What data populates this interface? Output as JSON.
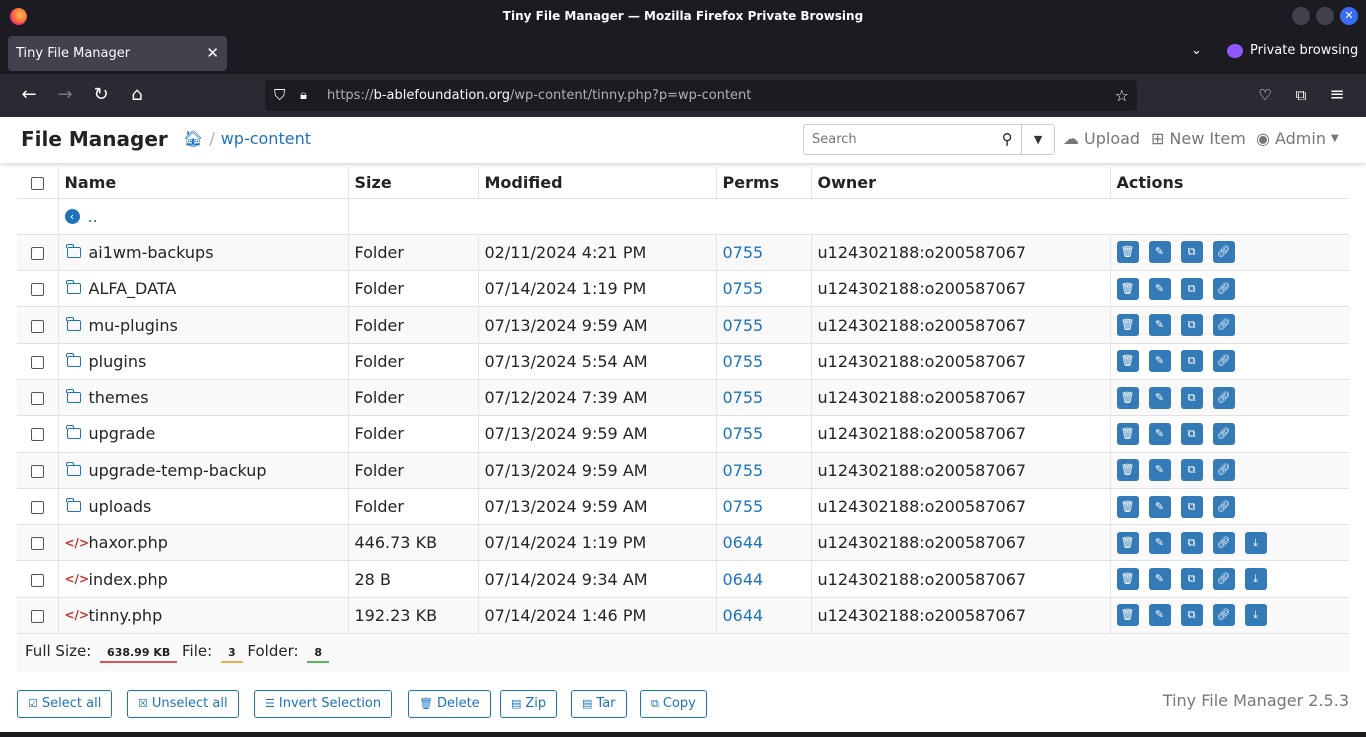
{
  "window": {
    "title": "Tiny File Manager — Mozilla Firefox Private Browsing"
  },
  "browser": {
    "tab_title": "Tiny File Manager",
    "private_label": "Private browsing",
    "url_prefix": "https://",
    "url_domain": "b-ablefoundation.org",
    "url_path": "/wp-content/tinny.php?p=wp-content"
  },
  "app": {
    "brand": "File Manager",
    "breadcrumb_sep": "/",
    "breadcrumb_current": "wp-content",
    "search_placeholder": "Search",
    "upload_label": "Upload",
    "new_item_label": "New Item",
    "admin_label": "Admin"
  },
  "table": {
    "headers": {
      "name": "Name",
      "size": "Size",
      "modified": "Modified",
      "perms": "Perms",
      "owner": "Owner",
      "actions": "Actions"
    },
    "up_label": "..",
    "rows": [
      {
        "type": "folder",
        "name": "ai1wm-backups",
        "size": "Folder",
        "modified": "02/11/2024 4:21 PM",
        "perms": "0755",
        "owner": "u124302188:o200587067"
      },
      {
        "type": "folder",
        "name": "ALFA_DATA",
        "size": "Folder",
        "modified": "07/14/2024 1:19 PM",
        "perms": "0755",
        "owner": "u124302188:o200587067"
      },
      {
        "type": "folder",
        "name": "mu-plugins",
        "size": "Folder",
        "modified": "07/13/2024 9:59 AM",
        "perms": "0755",
        "owner": "u124302188:o200587067"
      },
      {
        "type": "folder",
        "name": "plugins",
        "size": "Folder",
        "modified": "07/13/2024 5:54 AM",
        "perms": "0755",
        "owner": "u124302188:o200587067"
      },
      {
        "type": "folder",
        "name": "themes",
        "size": "Folder",
        "modified": "07/12/2024 7:39 AM",
        "perms": "0755",
        "owner": "u124302188:o200587067"
      },
      {
        "type": "folder",
        "name": "upgrade",
        "size": "Folder",
        "modified": "07/13/2024 9:59 AM",
        "perms": "0755",
        "owner": "u124302188:o200587067"
      },
      {
        "type": "folder",
        "name": "upgrade-temp-backup",
        "size": "Folder",
        "modified": "07/13/2024 9:59 AM",
        "perms": "0755",
        "owner": "u124302188:o200587067"
      },
      {
        "type": "folder",
        "name": "uploads",
        "size": "Folder",
        "modified": "07/13/2024 9:59 AM",
        "perms": "0755",
        "owner": "u124302188:o200587067"
      },
      {
        "type": "file",
        "name": "haxor.php",
        "size": "446.73 KB",
        "modified": "07/14/2024 1:19 PM",
        "perms": "0644",
        "owner": "u124302188:o200587067"
      },
      {
        "type": "file",
        "name": "index.php",
        "size": "28 B",
        "modified": "07/14/2024 9:34 AM",
        "perms": "0644",
        "owner": "u124302188:o200587067"
      },
      {
        "type": "file",
        "name": "tinny.php",
        "size": "192.23 KB",
        "modified": "07/14/2024 1:46 PM",
        "perms": "0644",
        "owner": "u124302188:o200587067"
      }
    ]
  },
  "summary": {
    "full_size_label": "Full Size:",
    "full_size_value": "638.99 KB",
    "file_label": "File:",
    "file_count": "3",
    "folder_label": "Folder:",
    "folder_count": "8"
  },
  "buttons": {
    "select_all": "Select all",
    "unselect_all": "Unselect all",
    "invert": "Invert Selection",
    "delete": "Delete",
    "zip": "Zip",
    "tar": "Tar",
    "copy": "Copy"
  },
  "version": "Tiny File Manager 2.5.3"
}
